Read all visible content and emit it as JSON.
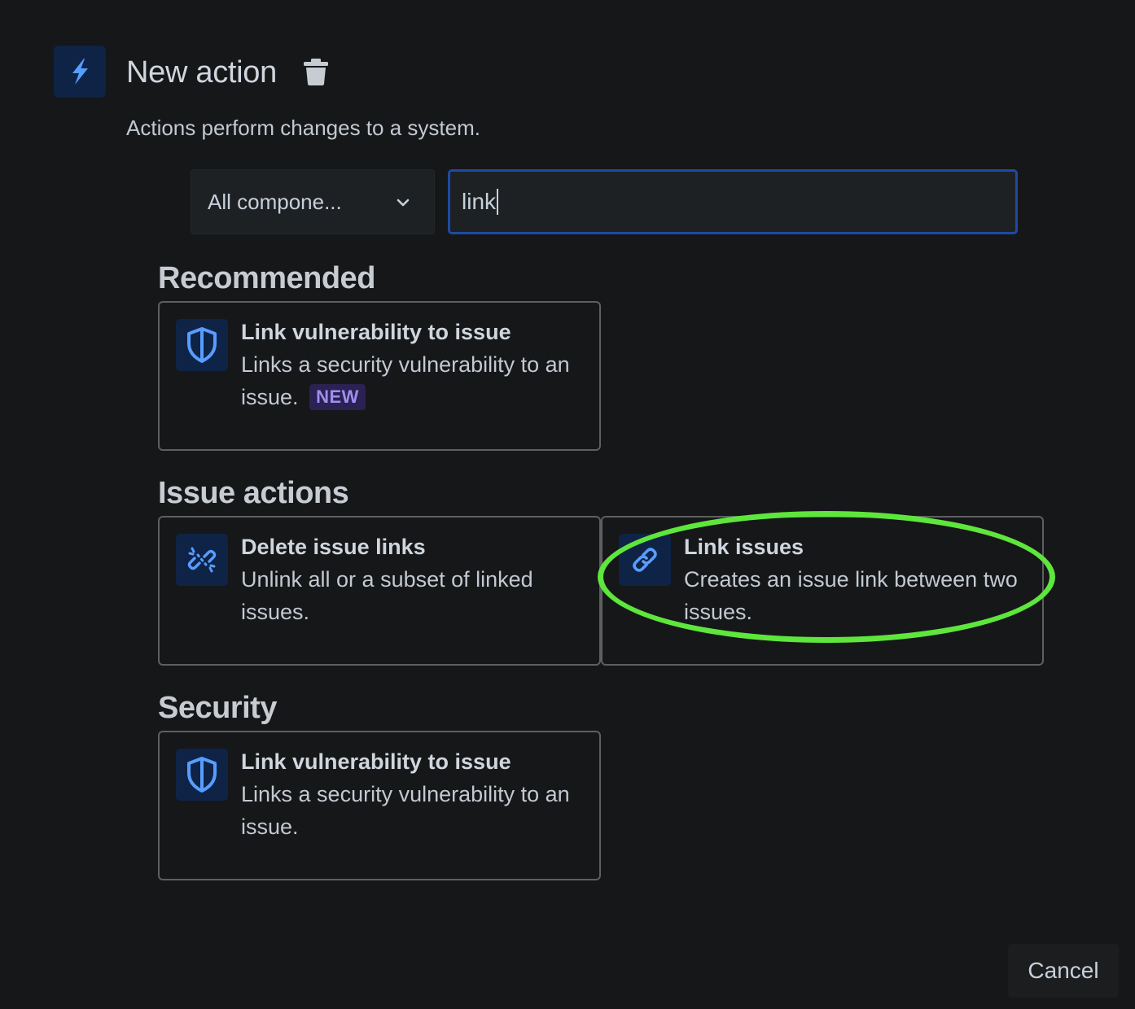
{
  "header": {
    "title": "New action",
    "subtitle": "Actions perform changes to a system.",
    "icon": "lightning-bolt-icon",
    "delete_icon": "trash-icon"
  },
  "filters": {
    "component_dropdown": {
      "selected": "All compone..."
    },
    "search": {
      "value": "link"
    }
  },
  "sections": [
    {
      "heading": "Recommended",
      "cards": [
        {
          "title": "Link vulnerability to issue",
          "description": "Links a security vulnerability to an issue.",
          "badge": "NEW",
          "icon": "shield-icon"
        }
      ]
    },
    {
      "heading": "Issue actions",
      "cards": [
        {
          "title": "Delete issue links",
          "description": "Unlink all or a subset of linked issues.",
          "icon": "broken-link-icon"
        },
        {
          "title": "Link issues",
          "description": "Creates an issue link between two issues.",
          "icon": "link-icon",
          "highlighted": true
        }
      ]
    },
    {
      "heading": "Security",
      "cards": [
        {
          "title": "Link vulnerability to issue",
          "description": "Links a security vulnerability to an issue.",
          "icon": "shield-icon"
        }
      ]
    }
  ],
  "footer": {
    "cancel_label": "Cancel"
  },
  "colors": {
    "background": "#161719",
    "icon_tile": "#0f2346",
    "icon_blue": "#579dff",
    "search_focus_border": "#1d4aa6",
    "badge_bg": "#2b2152",
    "badge_text": "#9f8fef",
    "highlight": "#5ee63c"
  }
}
